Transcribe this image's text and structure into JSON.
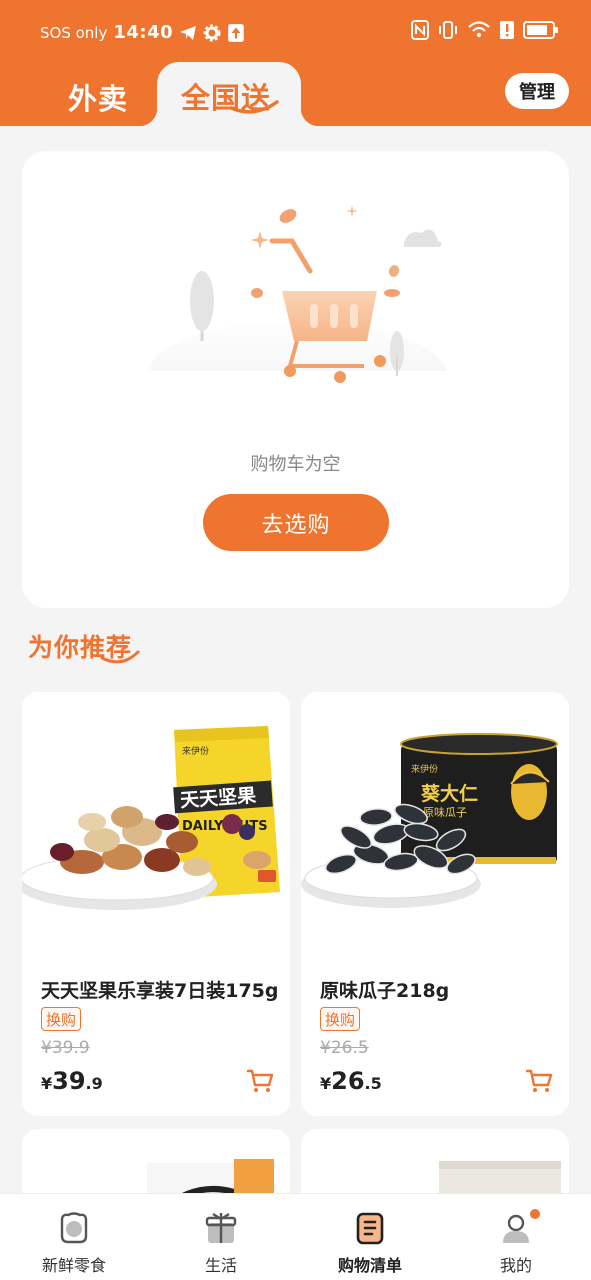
{
  "status_bar": {
    "network": "SOS only",
    "time": "14:40"
  },
  "header": {
    "tabs": [
      {
        "label": "外卖",
        "active": false
      },
      {
        "label": "全国送",
        "active": true
      }
    ],
    "manage_label": "管理"
  },
  "cart": {
    "empty_text": "购物车为空",
    "shop_button_label": "去选购"
  },
  "recommend": {
    "title": "为你推荐",
    "products": [
      {
        "name": "天天坚果乐享装7日装175g",
        "tag": "换购",
        "original_price": "¥39.9",
        "price_symbol": "¥",
        "price_int": "39",
        "price_dec": ".9",
        "package_text": "天天坚果",
        "package_brand": "来伊份",
        "package_en": "DAILY NUTS"
      },
      {
        "name": "原味瓜子218g",
        "tag": "换购",
        "original_price": "¥26.5",
        "price_symbol": "¥",
        "price_int": "26",
        "price_dec": ".5",
        "package_text": "葵大仁",
        "package_sub": "原味瓜子",
        "package_brand": "来伊份"
      }
    ]
  },
  "bottom_nav": [
    {
      "label": "新鲜零食",
      "icon": "fresh-snack-icon",
      "active": false
    },
    {
      "label": "生活",
      "icon": "life-icon",
      "active": false
    },
    {
      "label": "购物清单",
      "icon": "shopping-list-icon",
      "active": true
    },
    {
      "label": "我的",
      "icon": "profile-icon",
      "active": false,
      "badge": true
    }
  ],
  "colors": {
    "brand": "#ee7430",
    "background": "#f4f4f4"
  }
}
